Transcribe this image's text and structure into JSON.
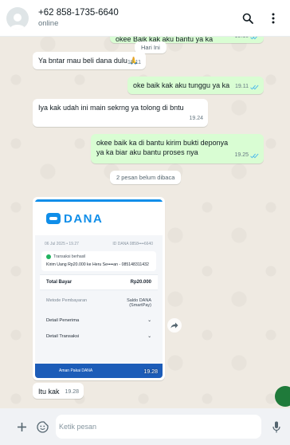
{
  "header": {
    "contact": "+62 858-1735-6640",
    "status": "online"
  },
  "messages": [
    {
      "dir": "out",
      "text": "okee Baik kak aku bantu ya ka",
      "time": "19.10"
    },
    {
      "dir": "system",
      "text": "Hari Ini"
    },
    {
      "dir": "in",
      "text": "Ya bntar mau beli dana dulu 🙏",
      "time": "19.11"
    },
    {
      "dir": "out",
      "text": "oke baik kak aku tunggu ya ka",
      "time": "19.11"
    },
    {
      "dir": "in",
      "text": "Iya kak udah ini main sekrng ya tolong di bntu",
      "time": "19.24"
    },
    {
      "dir": "out",
      "text": "okee baik ka di bantu kirim bukti deponya ya ka biar aku bantu proses nya",
      "time": "19.25"
    },
    {
      "dir": "system",
      "text": "2 pesan belum dibaca"
    },
    {
      "dir": "in",
      "text": "Itu kak",
      "time": "19.28"
    }
  ],
  "image_message": {
    "time": "19.28",
    "receipt": {
      "brand": "DANA",
      "date": "06 Jul 2025 • 19.27",
      "id": "ID DANA 0858••••6640",
      "status": "Transaksi berhasil",
      "description": "Kirim Uang Rp20.000 ke Heru Se••••an - 085148311432",
      "total_label": "Total Bayar",
      "total_value": "Rp20.000",
      "method_label": "Metode Pembayaran",
      "method_value": "Saldo DANA",
      "method_sub": "(SmartPay)",
      "detail_receiver": "Detail Penerima",
      "detail_transaction": "Detail Transaksi",
      "footer_text": "Aman Pakai DANA"
    }
  },
  "composer": {
    "placeholder": "Ketik pesan"
  },
  "colors": {
    "outgoing_bubble": "#d9fdd3",
    "incoming_bubble": "#ffffff",
    "read_tick": "#53bdeb",
    "dana_blue": "#108ee9"
  }
}
